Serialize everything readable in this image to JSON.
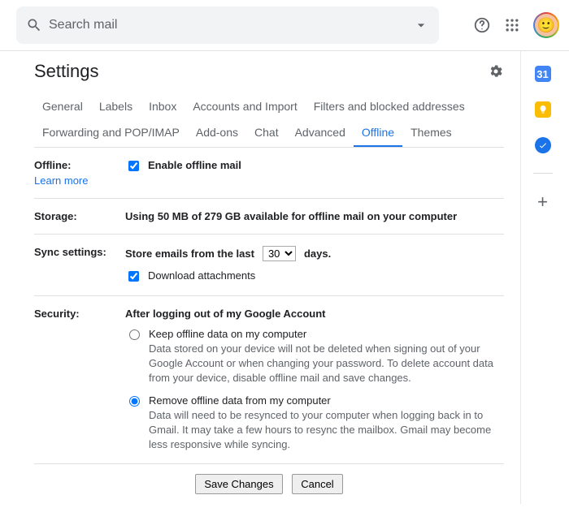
{
  "search": {
    "placeholder": "Search mail"
  },
  "header": {
    "title": "Settings"
  },
  "tabs": [
    {
      "label": "General",
      "active": false
    },
    {
      "label": "Labels",
      "active": false
    },
    {
      "label": "Inbox",
      "active": false
    },
    {
      "label": "Accounts and Import",
      "active": false
    },
    {
      "label": "Filters and blocked addresses",
      "active": false
    },
    {
      "label": "Forwarding and POP/IMAP",
      "active": false
    },
    {
      "label": "Add-ons",
      "active": false
    },
    {
      "label": "Chat",
      "active": false
    },
    {
      "label": "Advanced",
      "active": false
    },
    {
      "label": "Offline",
      "active": true
    },
    {
      "label": "Themes",
      "active": false
    }
  ],
  "offline": {
    "label": "Offline:",
    "learn_more": "Learn more",
    "checkbox_label": "Enable offline mail",
    "checked": true
  },
  "storage": {
    "label": "Storage:",
    "text": "Using 50 MB of 279 GB available for offline mail on your computer"
  },
  "sync": {
    "label": "Sync settings:",
    "prefix": "Store emails from the last",
    "value": "30",
    "suffix": "days.",
    "download_label": "Download attachments",
    "download_checked": true
  },
  "security": {
    "label": "Security:",
    "heading": "After logging out of my Google Account",
    "options": [
      {
        "label": "Keep offline data on my computer",
        "desc": "Data stored on your device will not be deleted when signing out of your Google Account or when changing your password. To delete account data from your device, disable offline mail and save changes.",
        "checked": false
      },
      {
        "label": "Remove offline data from my computer",
        "desc": "Data will need to be resynced to your computer when logging back in to Gmail. It may take a few hours to resync the mailbox. Gmail may become less responsive while syncing.",
        "checked": true
      }
    ]
  },
  "footer": {
    "save": "Save Changes",
    "cancel": "Cancel"
  },
  "sidepanel": {
    "calendar": "31"
  }
}
